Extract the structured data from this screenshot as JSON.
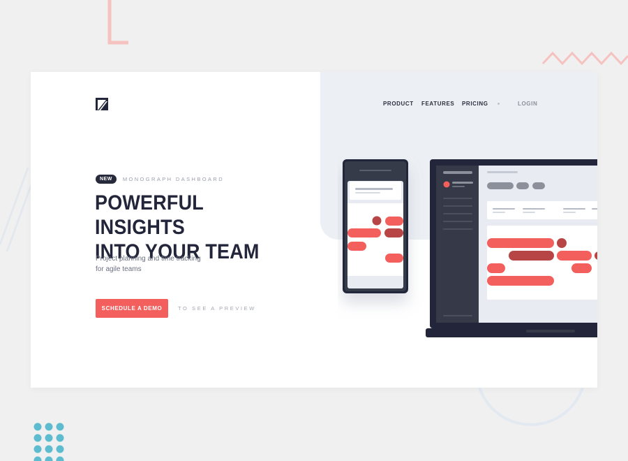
{
  "brand": {
    "logo": "monograph-logo-icon"
  },
  "nav": {
    "items": [
      {
        "label": "PRODUCT"
      },
      {
        "label": "FEATURES"
      },
      {
        "label": "PRICING"
      }
    ],
    "login": "LOGIN"
  },
  "hero": {
    "badge": "NEW",
    "eyebrow": "MONOGRAPH DASHBOARD",
    "headline": [
      "POWERFUL INSIGHTS",
      "INTO YOUR TEAM"
    ],
    "subtext": [
      "Project planning and time tracking",
      "for agile teams"
    ],
    "cta": "SCHEDULE A DEMO",
    "preview_link": "TO SEE A PREVIEW"
  },
  "colors": {
    "accent": "#f25f5c",
    "dark": "#23263a",
    "page_bg": "#f0f0f0",
    "hero_panel": "#eceff3"
  }
}
